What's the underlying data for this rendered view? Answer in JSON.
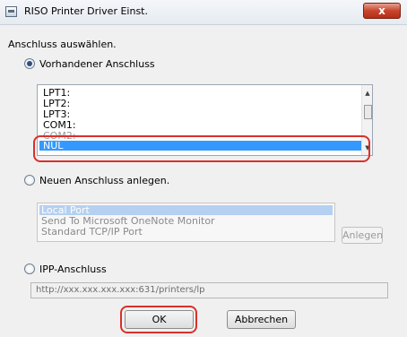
{
  "window": {
    "title": "RISO Printer Driver Einst.",
    "close_glyph": "x"
  },
  "instruction": "Anschluss auswählen.",
  "existing_port": {
    "label": "Vorhandener Anschluss",
    "selected": true,
    "items": [
      "LPT1:",
      "LPT2:",
      "LPT3:",
      "COM1:",
      "COM2:"
    ],
    "selected_item": "NUL"
  },
  "new_port": {
    "label": "Neuen Anschluss anlegen.",
    "selected": false,
    "items": [
      "Local Port",
      "Send To Microsoft OneNote Monitor",
      "Standard TCP/IP Port"
    ],
    "selected_index": 0,
    "create_button": "Anlegen"
  },
  "ipp_port": {
    "label": "IPP-Anschluss",
    "selected": false,
    "url": "http://xxx.xxx.xxx.xxx:631/printers/lp"
  },
  "buttons": {
    "ok": "OK",
    "cancel": "Abbrechen"
  },
  "colors": {
    "highlight_ring": "#d9302b",
    "selection": "#3399ff"
  }
}
